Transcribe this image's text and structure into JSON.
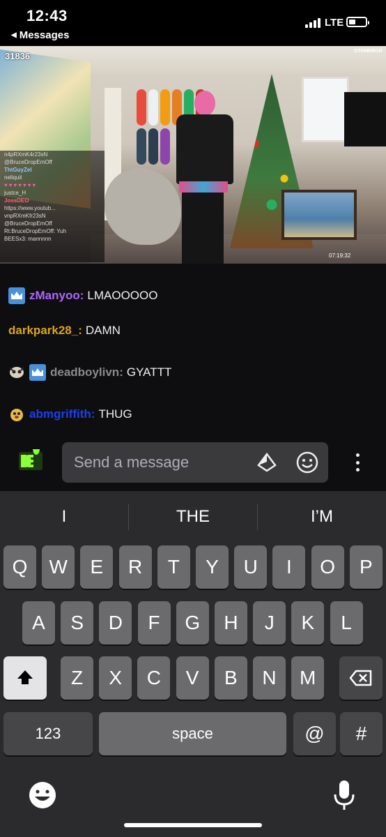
{
  "status_bar": {
    "time": "12:43",
    "back_label": "Messages",
    "network": "LTE"
  },
  "video": {
    "viewer_count": "31836",
    "brand": "OTKMERCH",
    "timestamp": "07:19:32",
    "overlay_chat": [
      "n4pRXmK4r23sN",
      "@BruceDropEmOff",
      "ThtGuyZel",
      "neliquit",
      "justce_H",
      "JossDEO",
      "https://www.youtub...",
      "vnpRXmKfr23sN",
      "@BruceDropEmOff",
      "Rt:BruceDropEmOff: Yuh",
      "BEESx3: mannnnn"
    ]
  },
  "chat": {
    "messages": [
      {
        "user": "zManyoo",
        "color": "#b066ff",
        "text": "LMAOOOOO"
      },
      {
        "user": "darkpark28_",
        "color": "#daa520",
        "text": "DAMN"
      },
      {
        "user": "deadboylivn",
        "color": "#8a8a8d",
        "text": "GYATTT"
      },
      {
        "user": "abmgriffith",
        "color": "#1e3ef0",
        "text": "THUG"
      }
    ],
    "input_placeholder": "Send a message"
  },
  "keyboard": {
    "suggestions": [
      "I",
      "THE",
      "I’M"
    ],
    "row1": [
      "Q",
      "W",
      "E",
      "R",
      "T",
      "Y",
      "U",
      "I",
      "O",
      "P"
    ],
    "row2": [
      "A",
      "S",
      "D",
      "F",
      "G",
      "H",
      "J",
      "K",
      "L"
    ],
    "row3": [
      "Z",
      "X",
      "C",
      "V",
      "B",
      "N",
      "M"
    ],
    "numbers_label": "123",
    "space_label": "space",
    "at_label": "@",
    "hash_label": "#"
  },
  "icons": [
    "signal-icon",
    "battery-icon",
    "crown-badge-icon",
    "bits-icon",
    "emote-picker-icon",
    "more-icon",
    "shift-icon",
    "backspace-icon",
    "emoji-keyboard-icon",
    "microphone-icon"
  ]
}
